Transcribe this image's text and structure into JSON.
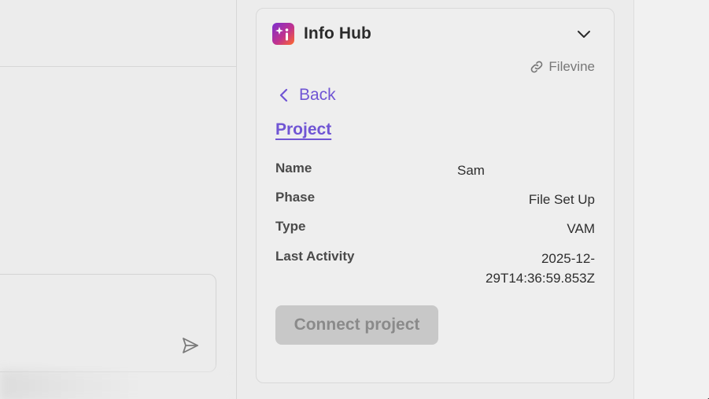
{
  "info_hub": {
    "title": "Info Hub",
    "source_link_label": "Filevine",
    "back_label": "Back",
    "section_title": "Project",
    "fields": [
      {
        "label": "Name",
        "value": "Sam"
      },
      {
        "label": "Phase",
        "value": "File Set Up"
      },
      {
        "label": "Type",
        "value": "VAM"
      },
      {
        "label": "Last Activity",
        "value_line1": "2025-12-",
        "value_line2": "29T14:36:59.853Z"
      }
    ],
    "connect_button_label": "Connect project"
  },
  "icons": {
    "app_logo": "sparkle-info-icon",
    "collapse": "chevron-down-icon",
    "link": "link-icon",
    "back": "chevron-left-icon",
    "send": "send-icon"
  },
  "colors": {
    "accent": "#7055d4",
    "disabled_button_bg": "#c8c8c8",
    "disabled_button_text": "#8a8a8a"
  }
}
